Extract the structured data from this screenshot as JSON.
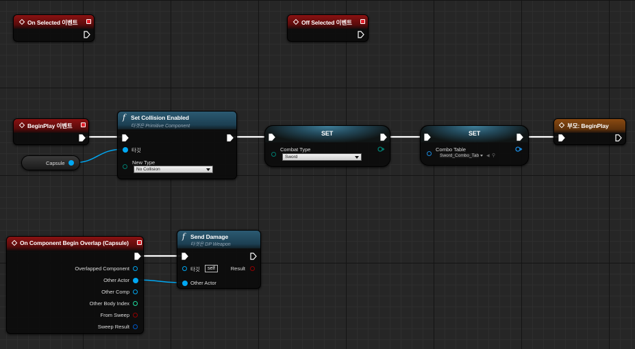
{
  "nodes": {
    "on_selected": {
      "title": "On Selected 이벤트"
    },
    "off_selected": {
      "title": "Off Selected 이벤트"
    },
    "begin_play": {
      "title": "BeginPlay 이벤트"
    },
    "capsule": {
      "label": "Capsule"
    },
    "set_collision": {
      "title": "Set Collision Enabled",
      "subtitle": "타겟은 Primitive Component",
      "target_label": "타깃",
      "new_type_label": "New Type",
      "new_type_value": "No Collision"
    },
    "set_combat": {
      "title": "SET",
      "field_label": "Combat Type",
      "field_value": "Sword"
    },
    "set_combo": {
      "title": "SET",
      "field_label": "Combo Table",
      "field_value": "Sword_Combo_Tab"
    },
    "parent_begin_play": {
      "title": "부모: BeginPlay"
    },
    "overlap": {
      "title": "On Component Begin Overlap (Capsule)",
      "pins": [
        "Overlapped Component",
        "Other Actor",
        "Other Comp",
        "Other Body Index",
        "From Sweep",
        "Sweep Result"
      ]
    },
    "send_damage": {
      "title": "Send Damage",
      "subtitle": "타겟은 DP Weapon",
      "target_label": "타깃",
      "target_value": "self",
      "result_label": "Result",
      "other_actor_label": "Other Actor"
    }
  },
  "colors": {
    "exec": "#ffffff",
    "object": "#00a8f3",
    "byte": "#006f65",
    "int": "#1fe0a0",
    "bool": "#940000",
    "struct": "#0059cb",
    "event_header": "#8a1212",
    "function_header": "#2b5a72",
    "parent_header": "#8a4a12"
  }
}
